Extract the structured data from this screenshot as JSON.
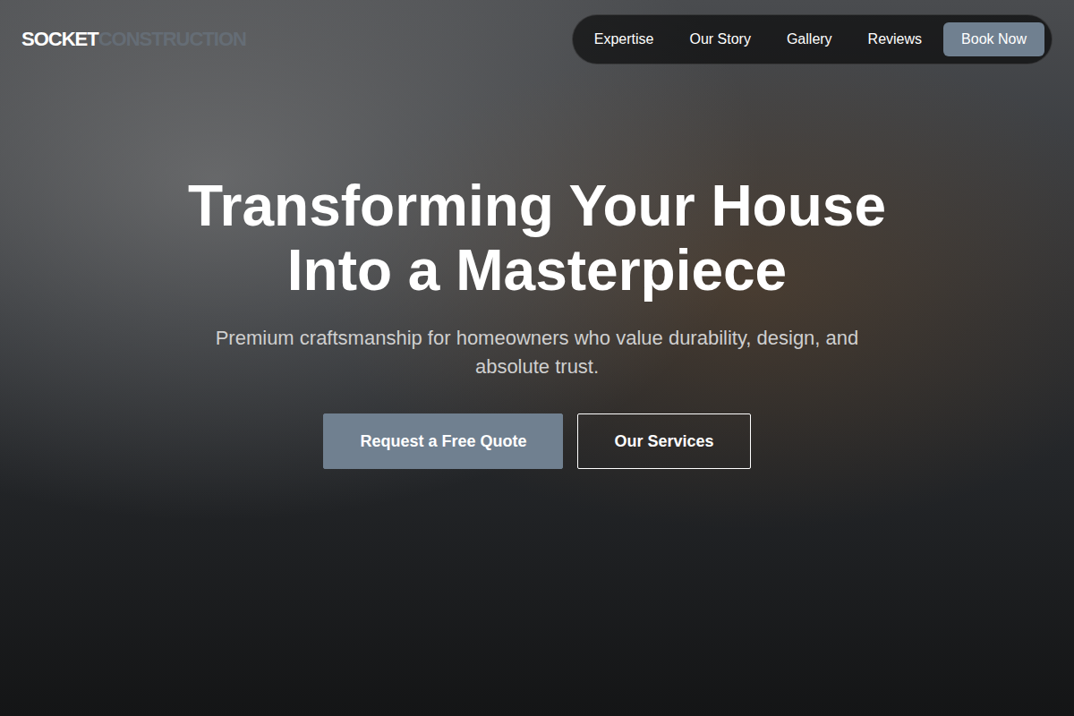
{
  "logo": {
    "primary": "SOCKET",
    "secondary": "CONSTRUCTION"
  },
  "nav": {
    "items": [
      {
        "label": "Expertise"
      },
      {
        "label": "Our Story"
      },
      {
        "label": "Gallery"
      },
      {
        "label": "Reviews"
      }
    ],
    "cta": "Book Now"
  },
  "hero": {
    "headline": [
      "Transforming Your House",
      "Into a Masterpiece"
    ],
    "subtitle": "Premium craftsmanship for homeowners who value durability, design, and absolute trust.",
    "buttons": [
      {
        "label": "Request a Free Quote",
        "kind": "primary"
      },
      {
        "label": "Our Services",
        "kind": "outline"
      }
    ]
  }
}
